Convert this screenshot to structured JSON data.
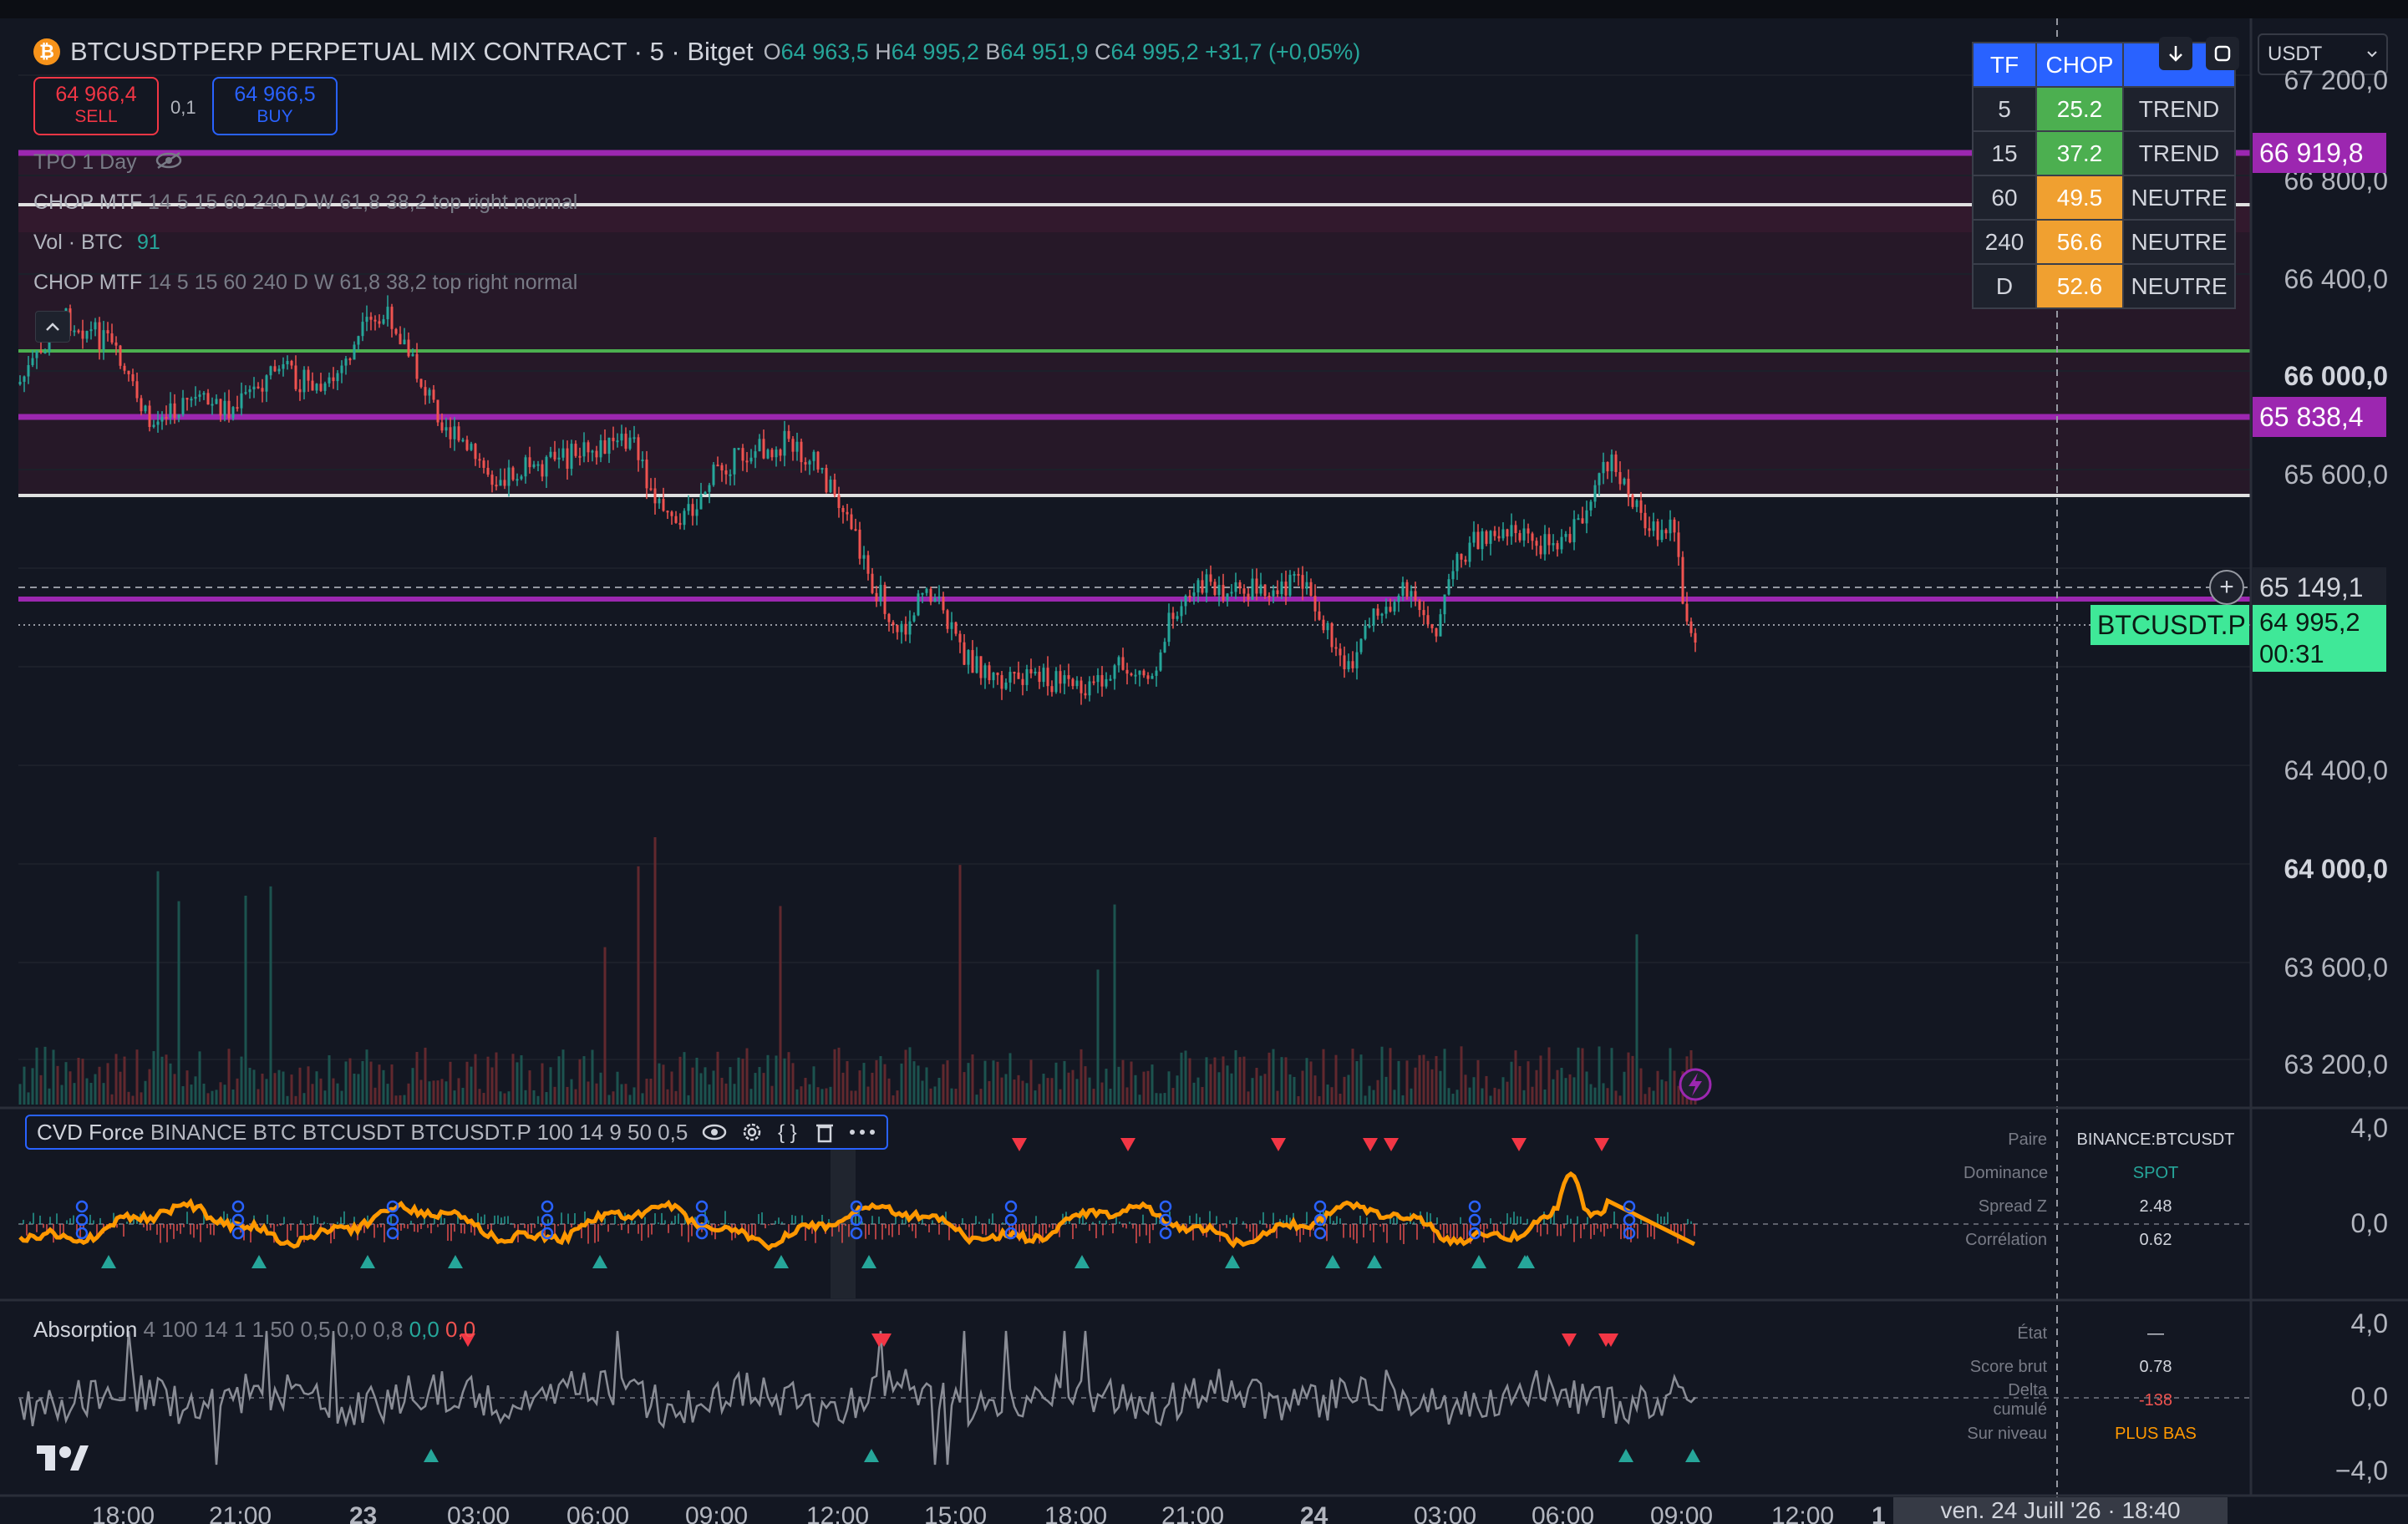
{
  "symbol": {
    "title": "BTCUSDTPERP PERPETUAL MIX CONTRACT · 5 · Bitget",
    "badge": "₿",
    "ohlc": {
      "o_k": "O",
      "o": "64 963,5",
      "h_k": "H",
      "h": "64 995,2",
      "l_k": "B",
      "l": "64 951,9",
      "c_k": "C",
      "c": "64 995,2",
      "chg": "+31,7 (+0,05%)"
    }
  },
  "trade": {
    "sell_price": "64 966,4",
    "sell_label": "SELL",
    "spread": "0,1",
    "buy_price": "64 966,5",
    "buy_label": "BUY"
  },
  "legends": {
    "tpo": "TPO 1 Day",
    "chop1_name": "CHOP MTF",
    "chop1_params": "14 5 15 60 240 D W 61,8 38,2 top right normal",
    "vol_name": "Vol · BTC",
    "vol_value": "91",
    "chop2_name": "CHOP MTF",
    "chop2_params": "14 5 15 60 240 D W 61,8 38,2 top right normal"
  },
  "chop_table": {
    "headers": [
      "TF",
      "CHOP",
      ""
    ],
    "rows": [
      {
        "tf": "5",
        "chop": "25.2",
        "state": "TREND",
        "color": "green"
      },
      {
        "tf": "15",
        "chop": "37.2",
        "state": "TREND",
        "color": "green"
      },
      {
        "tf": "60",
        "chop": "49.5",
        "state": "NEUTRE",
        "color": "orange"
      },
      {
        "tf": "240",
        "chop": "56.6",
        "state": "NEUTRE",
        "color": "orange"
      },
      {
        "tf": "D",
        "chop": "52.6",
        "state": "NEUTRE",
        "color": "orange"
      }
    ]
  },
  "currency_select": "USDT",
  "price_scale": {
    "labels": [
      "67 200,0",
      "66 800,0",
      "66 400,0",
      "66 000,0",
      "65 600,0",
      "64 400,0",
      "64 000,0",
      "63 600,0",
      "63 200,0"
    ],
    "tag_purple_top": "66 919,8",
    "tag_purple_mid": "65 838,4",
    "crosshair_price": "65 149,1",
    "symbol_tag": "BTCUSDT.P",
    "last_price": "64 995,2",
    "countdown": "00:31"
  },
  "cvd": {
    "name": "CVD Force",
    "params": "BINANCE BTC BTCUSDT BTCUSDT.P 100 14 9 50 0,5",
    "scale": [
      "4,0",
      "0,0"
    ],
    "info": [
      {
        "k": "Paire",
        "v": "BINANCE:BTCUSDT"
      },
      {
        "k": "Dominance",
        "v": "SPOT"
      },
      {
        "k": "Spread Z",
        "v": "2.48"
      },
      {
        "k": "Corrélation",
        "v": "0.62"
      }
    ]
  },
  "absorption": {
    "name": "Absorption",
    "params": "4 100 14 1 1 50 0,5",
    "v1": "0,0",
    "v2": "0,8",
    "v3": "0,0",
    "v4": "0,0",
    "scale": [
      "4,0",
      "0,0",
      "−4,0"
    ],
    "info": [
      {
        "k": "État",
        "v": "—"
      },
      {
        "k": "Score brut",
        "v": "0.78"
      },
      {
        "k": "Delta cumulé",
        "v": "-138"
      },
      {
        "k": "Sur niveau",
        "v": "PLUS BAS"
      }
    ]
  },
  "time_axis": {
    "labels": [
      "18:00",
      "21:00",
      "23",
      "03:00",
      "06:00",
      "09:00",
      "12:00",
      "15:00",
      "18:00",
      "21:00",
      "24",
      "03:00",
      "06:00",
      "09:00",
      "12:00",
      "1"
    ],
    "crosshair_time": "ven. 24 Juill '26 · 18:40"
  },
  "colors": {
    "purple": "#9c27b0",
    "green_line": "#4caf50",
    "up": "#26a69a",
    "down": "#ef5350",
    "accent": "#2962ff",
    "orange": "#ff9800"
  }
}
